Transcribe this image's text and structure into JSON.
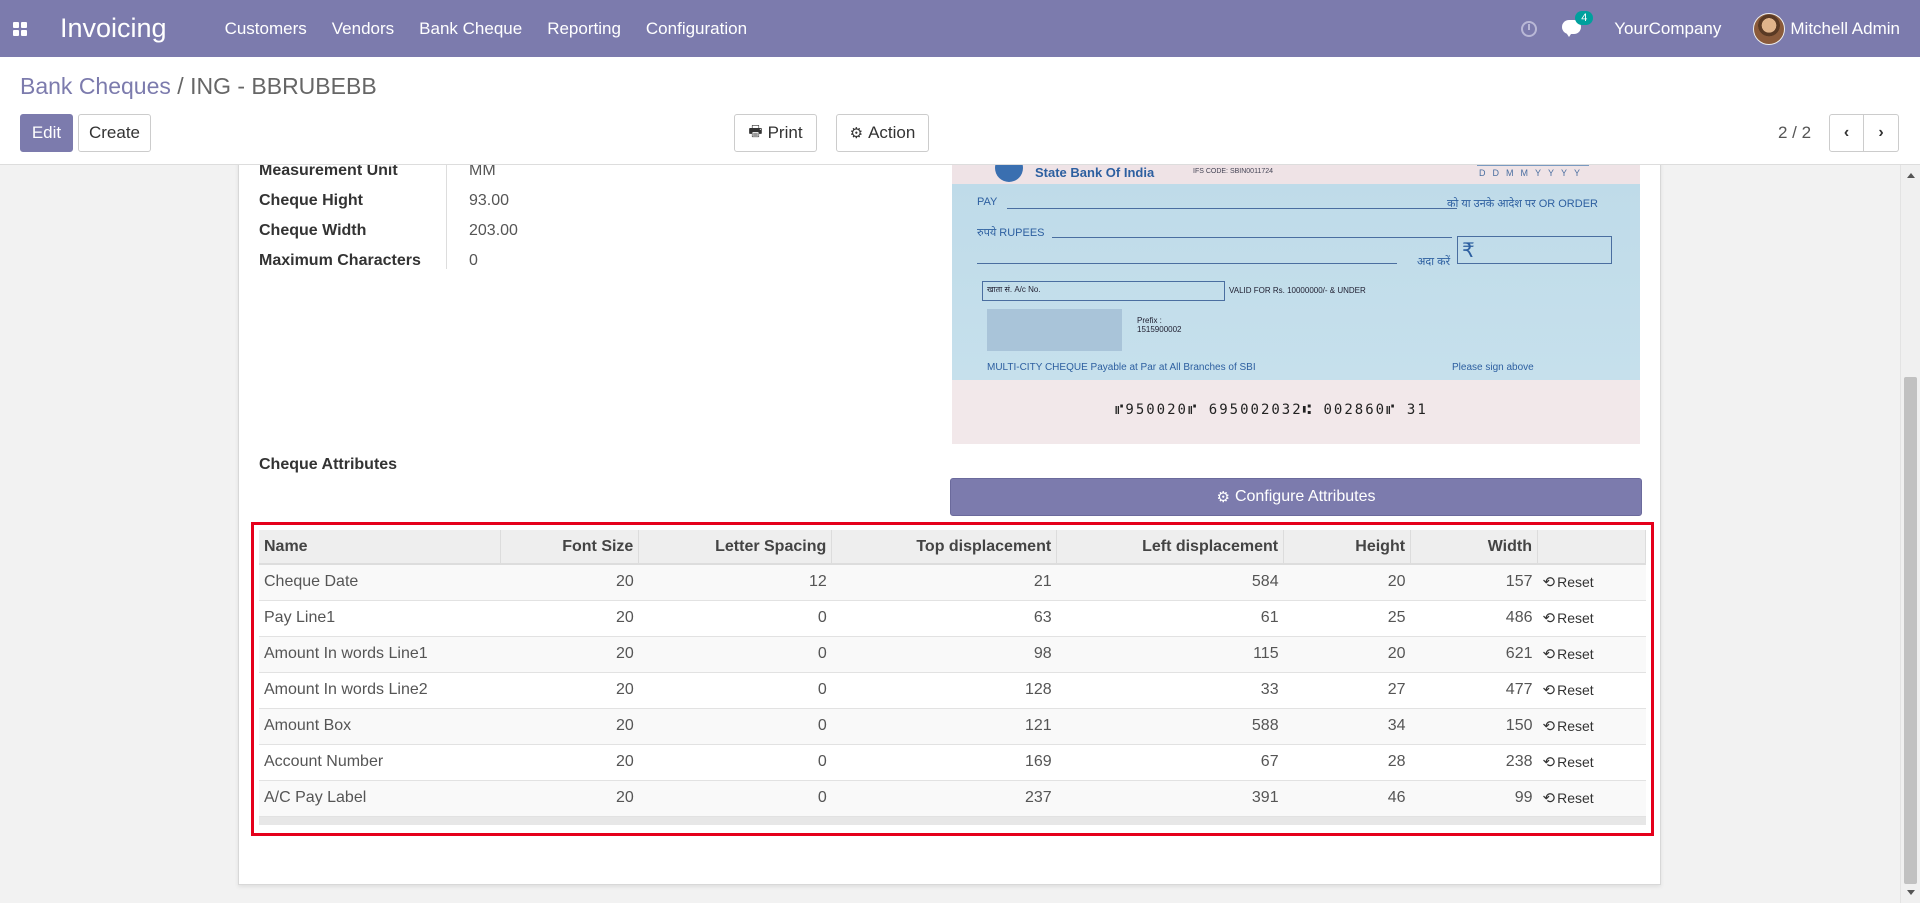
{
  "navbar": {
    "app_title": "Invoicing",
    "menu": [
      "Customers",
      "Vendors",
      "Bank Cheque",
      "Reporting",
      "Configuration"
    ],
    "messages_count": "4",
    "company": "YourCompany",
    "user": "Mitchell Admin",
    "accent": "#7c7bad"
  },
  "breadcrumb": {
    "parent": "Bank Cheques",
    "separator": "/",
    "current": "ING - BBRUBEBB"
  },
  "buttons": {
    "edit": "Edit",
    "create": "Create",
    "print": "Print",
    "action": "Action"
  },
  "pager": {
    "value": "2 / 2"
  },
  "fields": [
    {
      "label": "Measurement Unit",
      "value": "MM"
    },
    {
      "label": "Cheque Hight",
      "value": "93.00"
    },
    {
      "label": "Cheque Width",
      "value": "203.00"
    },
    {
      "label": "Maximum Characters",
      "value": "0"
    }
  ],
  "cheque_image": {
    "bank_name": "State Bank Of India",
    "ifs_code": "IFS CODE: SBIN0011724",
    "date_letters": "DDMMYYYY",
    "pay": "PAY",
    "or_order": "को या उनके आदेश पर  OR ORDER",
    "rupees": "रुपये RUPEES",
    "ada": "अदा करें",
    "valid_for": "VALID FOR Rs. 10000000/- & UNDER",
    "acc_label": "खाता सं. A/c No.",
    "prefix": "Prefix : 1515900002",
    "multi_city": "MULTI-CITY CHEQUE Payable at Par at All Branches of SBI",
    "sign": "Please sign above",
    "micr": "⑈950020⑈ 695002032⑆ 002860⑈ 31"
  },
  "section": {
    "title": "Cheque Attributes",
    "configure_button": "Configure Attributes"
  },
  "table": {
    "columns": [
      "Name",
      "Font Size",
      "Letter Spacing",
      "Top displacement",
      "Left displacement",
      "Height",
      "Width"
    ],
    "reset_label": "Reset",
    "rows": [
      {
        "name": "Cheque Date",
        "font_size": "20",
        "letter_spacing": "12",
        "top": "21",
        "left": "584",
        "height": "20",
        "width": "157"
      },
      {
        "name": "Pay Line1",
        "font_size": "20",
        "letter_spacing": "0",
        "top": "63",
        "left": "61",
        "height": "25",
        "width": "486"
      },
      {
        "name": "Amount In words Line1",
        "font_size": "20",
        "letter_spacing": "0",
        "top": "98",
        "left": "115",
        "height": "20",
        "width": "621"
      },
      {
        "name": "Amount In words Line2",
        "font_size": "20",
        "letter_spacing": "0",
        "top": "128",
        "left": "33",
        "height": "27",
        "width": "477"
      },
      {
        "name": "Amount Box",
        "font_size": "20",
        "letter_spacing": "0",
        "top": "121",
        "left": "588",
        "height": "34",
        "width": "150"
      },
      {
        "name": "Account Number",
        "font_size": "20",
        "letter_spacing": "0",
        "top": "169",
        "left": "67",
        "height": "28",
        "width": "238"
      },
      {
        "name": "A/C Pay Label",
        "font_size": "20",
        "letter_spacing": "0",
        "top": "237",
        "left": "391",
        "height": "46",
        "width": "99"
      }
    ]
  }
}
